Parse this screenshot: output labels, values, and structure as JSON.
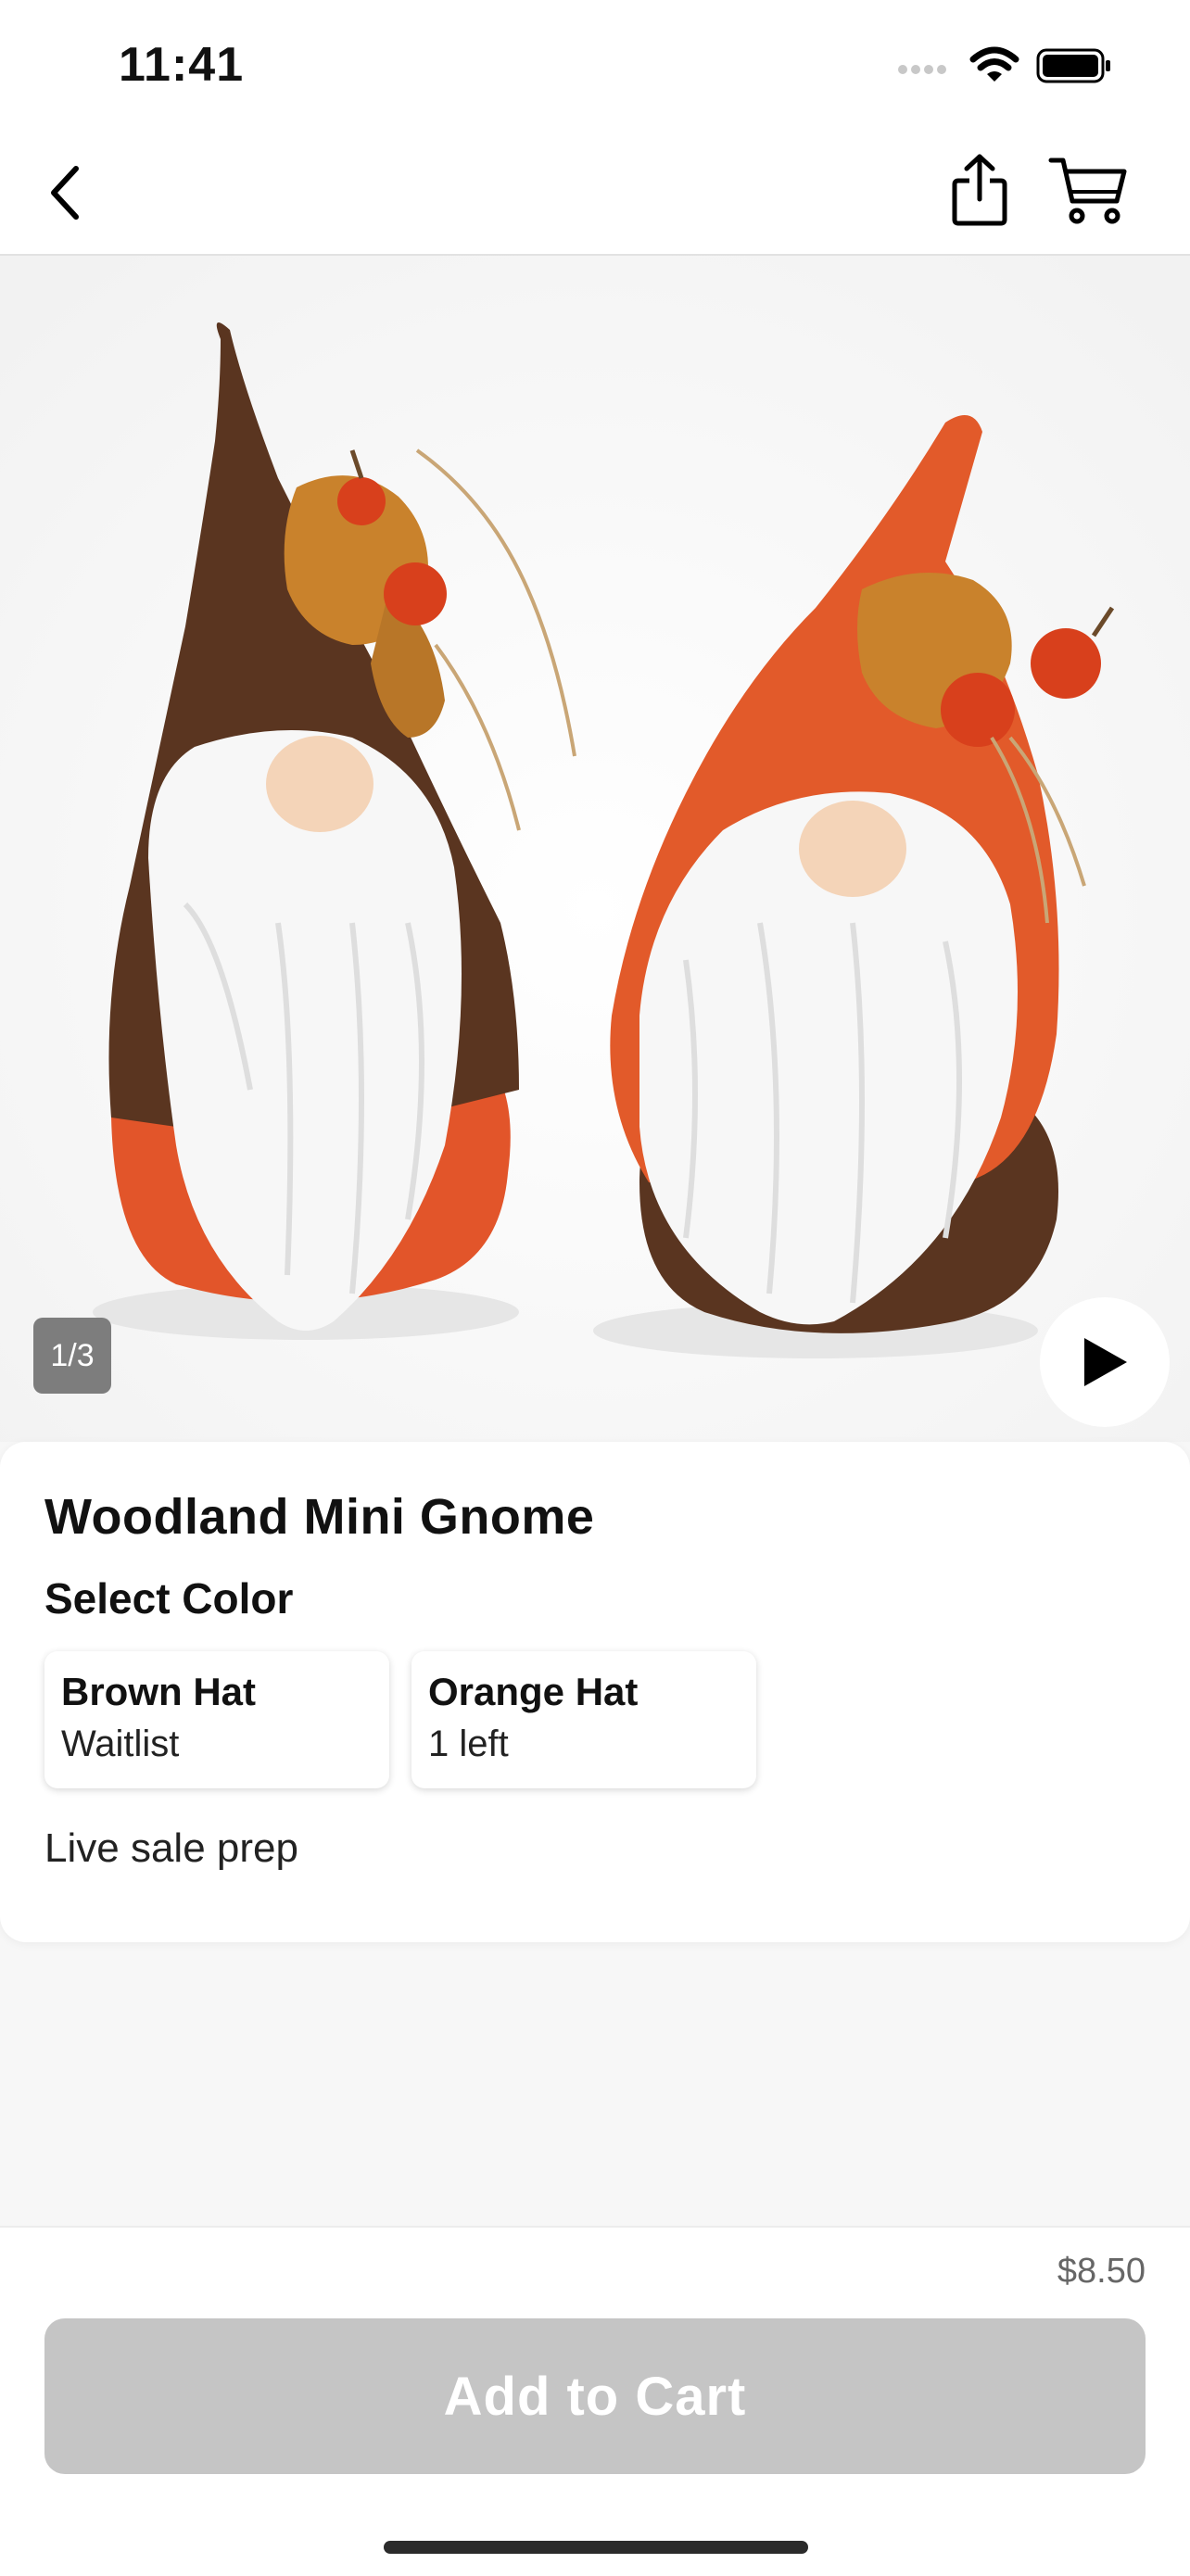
{
  "status_bar": {
    "time": "11:41"
  },
  "nav": {
    "icons": [
      "chevron-left-icon",
      "share-icon",
      "cart-icon"
    ]
  },
  "gallery": {
    "counter": "1/3",
    "play_icon": "play-icon"
  },
  "product": {
    "title": "Woodland Mini Gnome",
    "color_label": "Select Color",
    "variants": [
      {
        "name": "Brown Hat",
        "status": "Waitlist"
      },
      {
        "name": "Orange Hat",
        "status": "1 left"
      }
    ],
    "note": "Live sale prep"
  },
  "footer": {
    "price": "$8.50",
    "add_to_cart_label": "Add to Cart"
  },
  "colors": {
    "button_disabled": "#c5c5c5",
    "brown_hat": "#5a3520",
    "orange_hat": "#e25a2a"
  }
}
